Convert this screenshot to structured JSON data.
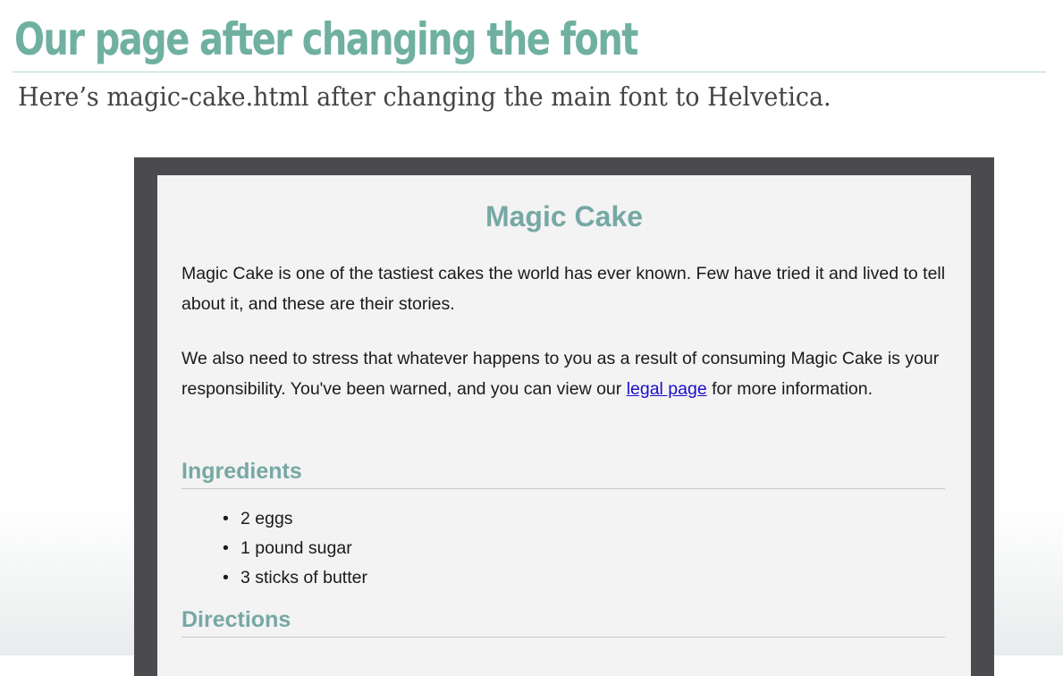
{
  "slide": {
    "title": "Our page after changing the font",
    "subtitle": "Here’s magic-cake.html after changing the main font to Helvetica."
  },
  "page": {
    "title": "Magic Cake",
    "paragraph1": "Magic Cake is one of the tastiest cakes the world has ever known. Few have tried it and lived to tell about it, and these are their stories.",
    "paragraph2_before_link": "We also need to stress that whatever happens to you as a result of consuming Magic Cake is your responsibility. You've been warned, and you can view our ",
    "legal_link": "legal page",
    "paragraph2_after_link": " for more information.",
    "ingredients_heading": "Ingredients",
    "ingredients": [
      "2 eggs",
      "1 pound sugar",
      "3 sticks of butter"
    ],
    "directions_heading": "Directions",
    "bullet": "•"
  },
  "colors": {
    "slide_title": "#6fb0a0",
    "heading": "#76a8a4",
    "link": "#1a0dcc",
    "frame": "#4a4a4f"
  }
}
